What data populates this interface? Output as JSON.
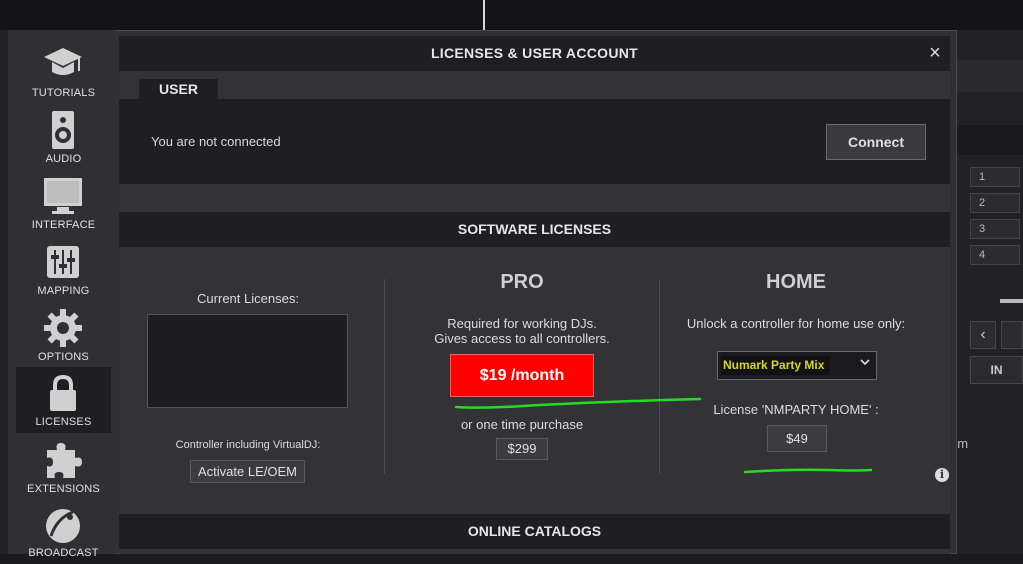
{
  "dialog": {
    "title": "LICENSES & USER ACCOUNT",
    "close_symbol": "×"
  },
  "sidebar": {
    "items": [
      {
        "label": "TUTORIALS",
        "icon": "graduation-cap-icon"
      },
      {
        "label": "AUDIO",
        "icon": "speaker-icon"
      },
      {
        "label": "INTERFACE",
        "icon": "monitor-icon"
      },
      {
        "label": "MAPPING",
        "icon": "sliders-icon"
      },
      {
        "label": "OPTIONS",
        "icon": "gear-icon"
      },
      {
        "label": "LICENSES",
        "icon": "lock-icon",
        "active": true
      },
      {
        "label": "EXTENSIONS",
        "icon": "puzzle-icon"
      },
      {
        "label": "BROADCAST",
        "icon": "satellite-dish-icon"
      }
    ]
  },
  "user": {
    "tab_label": "USER",
    "status_text": "You are not connected",
    "connect_label": "Connect"
  },
  "software_licenses": {
    "title": "SOFTWARE LICENSES",
    "current": {
      "label": "Current Licenses:",
      "controller_text": "Controller including VirtualDJ:",
      "activate_label": "Activate LE/OEM"
    },
    "pro": {
      "heading": "PRO",
      "desc_line1": "Required for working DJs.",
      "desc_line2": "Gives access to all controllers.",
      "price_label": "$19 /month",
      "alt_text": "or one time purchase",
      "alt_price": "$299",
      "price_color": "#ff0000"
    },
    "home": {
      "heading": "HOME",
      "desc": "Unlock a controller for home use only:",
      "selected_controller": "Numark Party Mix",
      "license_name": "License 'NMPARTY HOME' :",
      "price": "$49"
    },
    "info_symbol": "i"
  },
  "online_catalogs": {
    "title": "ONLINE CATALOGS"
  },
  "background": {
    "deck_numbers": [
      "1",
      "2",
      "3",
      "4"
    ],
    "left_arrow": "‹",
    "in_label": "IN",
    "partial_text": "om"
  },
  "annotation_color": "#22dd22"
}
